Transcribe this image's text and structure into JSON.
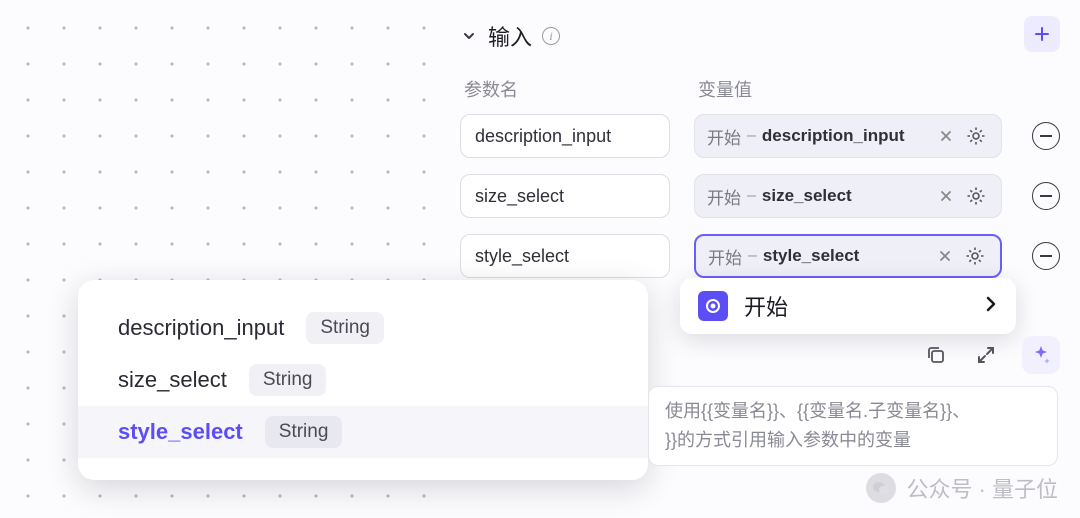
{
  "section": {
    "title": "输入",
    "col_param": "参数名",
    "col_value": "变量值",
    "source_prefix": "开始"
  },
  "params": [
    {
      "name": "description_input",
      "var": "description_input",
      "active": false
    },
    {
      "name": "size_select",
      "var": "size_select",
      "active": false
    },
    {
      "name": "style_select",
      "var": "style_select",
      "active": true
    }
  ],
  "autocomplete": {
    "items": [
      {
        "name": "description_input",
        "type": "String",
        "selected": false
      },
      {
        "name": "size_select",
        "type": "String",
        "selected": false
      },
      {
        "name": "style_select",
        "type": "String",
        "selected": true
      }
    ]
  },
  "node_menu": {
    "label": "开始"
  },
  "hint": "使用{{变量名}}、{{变量名.子变量名}}、\n}}的方式引用输入参数中的变量",
  "watermark": {
    "text": "公众号 · 量子位"
  }
}
